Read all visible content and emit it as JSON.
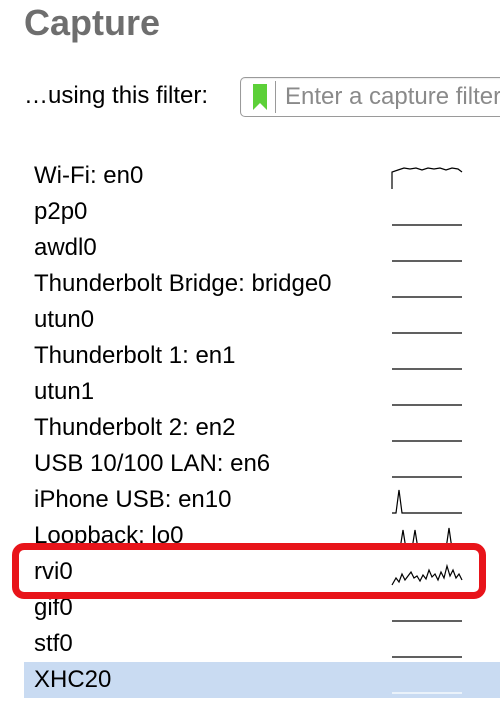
{
  "section": {
    "title": "Capture"
  },
  "filter": {
    "label": "…using this filter:",
    "placeholder": "Enter a capture filter",
    "bookmark_icon": "bookmark-icon",
    "bookmark_color": "#5cd038"
  },
  "interfaces": [
    {
      "name": "Wi-Fi: en0",
      "activity": "wifi"
    },
    {
      "name": "p2p0",
      "activity": "flat"
    },
    {
      "name": "awdl0",
      "activity": "flat"
    },
    {
      "name": "Thunderbolt Bridge: bridge0",
      "activity": "flat"
    },
    {
      "name": "utun0",
      "activity": "flat"
    },
    {
      "name": "Thunderbolt 1: en1",
      "activity": "flat"
    },
    {
      "name": "utun1",
      "activity": "flat"
    },
    {
      "name": "Thunderbolt 2: en2",
      "activity": "flat"
    },
    {
      "name": "USB 10/100 LAN: en6",
      "activity": "flat"
    },
    {
      "name": "iPhone USB: en10",
      "activity": "spike"
    },
    {
      "name": "Loopback: lo0",
      "activity": "loopback"
    },
    {
      "name": "rvi0",
      "activity": "noisy"
    },
    {
      "name": "gif0",
      "activity": "flat"
    },
    {
      "name": "stf0",
      "activity": "flat"
    },
    {
      "name": "XHC20",
      "activity": "flat"
    }
  ],
  "selected_interface": "XHC20",
  "highlighted_interface": "rvi0",
  "colors": {
    "highlight_border": "#e8141a",
    "selected_row": "#c9dbf2",
    "title": "#6e6e6e"
  }
}
